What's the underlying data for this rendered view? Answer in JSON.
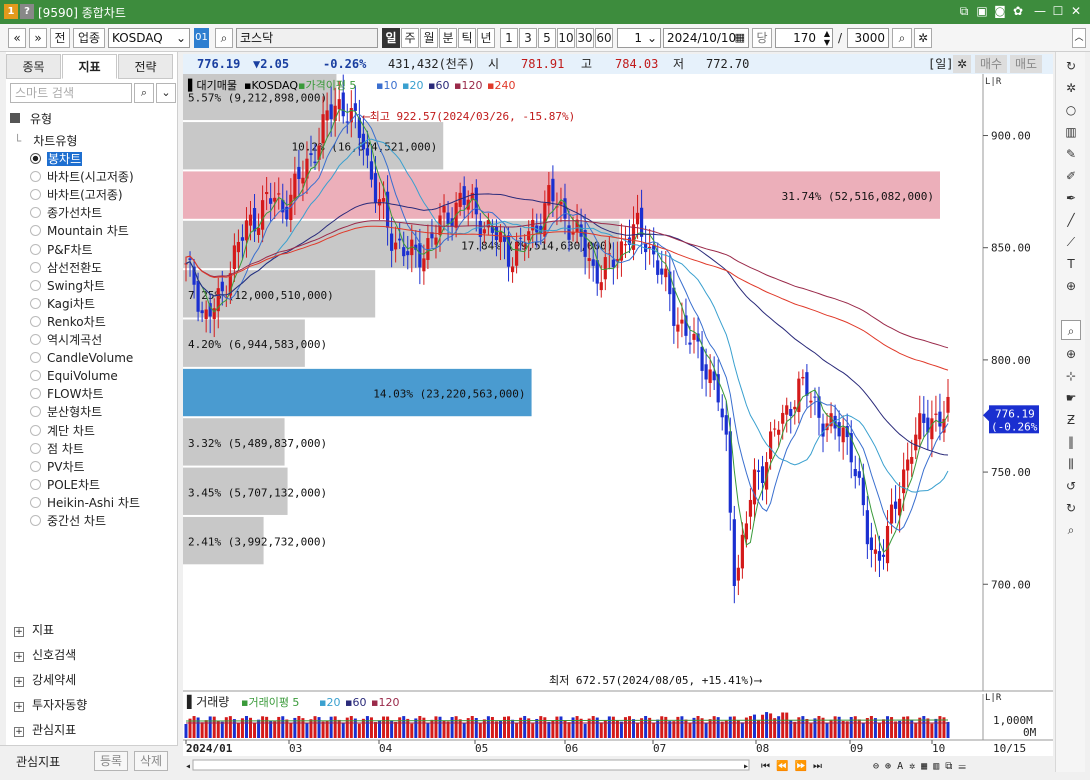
{
  "window": {
    "title": "[9590] 종합차트",
    "badge1": "1",
    "badge2": "?"
  },
  "toolbar": {
    "nav_back": "«",
    "nav_down": "»",
    "btn_all": "전",
    "btn_sector": "업종",
    "market_select": "KOSDAQ",
    "code_tag": "01",
    "index_name": "코스닥",
    "periods": [
      "일",
      "주",
      "월",
      "분",
      "틱",
      "년"
    ],
    "active_period": "일",
    "intervals": [
      "1",
      "3",
      "5",
      "10",
      "30",
      "60"
    ],
    "interval_value": "1",
    "date": "2024/10/10",
    "unit_label": "당",
    "count": "170",
    "slash": "/",
    "total": "3000"
  },
  "left_panel": {
    "tabs": [
      "종목",
      "지표",
      "전략"
    ],
    "active_tab": "지표",
    "search_placeholder": "스마트 검색",
    "folder_label": "유형",
    "group_label": "차트유형",
    "chart_types": [
      "봉차트",
      "바차트(시고저종)",
      "바차트(고저종)",
      "종가선차트",
      "Mountain 차트",
      "P&F차트",
      "삼선전환도",
      "Swing차트",
      "Kagi차트",
      "Renko차트",
      "역시계곡선",
      "CandleVolume",
      "EquiVolume",
      "FLOW차트",
      "분산형차트",
      "계단 차트",
      "점 차트",
      "PV차트",
      "POLE차트",
      "Heikin-Ashi 차트",
      "중간선 차트"
    ],
    "selected_type": "봉차트",
    "bottom_items": [
      "지표",
      "신호검색",
      "강세약세",
      "투자자동향",
      "관심지표"
    ],
    "watch_label": "관심지표",
    "register_btn": "등록",
    "delete_btn": "삭제"
  },
  "price_bar": {
    "last": "776.19",
    "change": "▼2.05",
    "change_pct": "-0.26%",
    "volume": "431,432(천주)",
    "open_label": "시",
    "open": "781.91",
    "high_label": "고",
    "high": "784.03",
    "low_label": "저",
    "low": "772.70",
    "period_tag": "[일]",
    "buy_btn": "매수",
    "sell_btn": "매도"
  },
  "legend": {
    "items": [
      {
        "label": "대기매물",
        "color": "#000000"
      },
      {
        "label": "KOSDAQ",
        "color": "#000000"
      },
      {
        "label": "가격이평 5",
        "color": "#3a9a3a"
      },
      {
        "label": "10",
        "color": "#3a6fcf"
      },
      {
        "label": "20",
        "color": "#3aa0cf"
      },
      {
        "label": "60",
        "color": "#2a2a7a"
      },
      {
        "label": "120",
        "color": "#9a2a4a"
      },
      {
        "label": "240",
        "color": "#e03a2a"
      }
    ]
  },
  "annotations": {
    "high": "최고 922.57(2024/03/26, -15.87%)",
    "low": "최저 672.57(2024/08/05, +15.41%)",
    "current_price": "776.19",
    "current_pct": "(-0.26%)"
  },
  "volume_legend": {
    "title": "거래량",
    "items": [
      {
        "label": "거래이평 5",
        "color": "#3a9a3a"
      },
      {
        "label": "20",
        "color": "#3aa0cf"
      },
      {
        "label": "60",
        "color": "#2a2a7a"
      },
      {
        "label": "120",
        "color": "#9a2a4a"
      }
    ],
    "scale_top": "1,000M",
    "scale_bottom": "0M"
  },
  "x_axis": {
    "labels": [
      "2024/01",
      "03",
      "04",
      "05",
      "06",
      "07",
      "08",
      "09",
      "10"
    ],
    "current_date": "10/15"
  },
  "chart_data": {
    "type": "candlestick",
    "ylim": [
      660,
      935
    ],
    "y_ticks": [
      700,
      750,
      800,
      850,
      900
    ],
    "y_tick_labels": [
      "700.00",
      "750.00",
      "800.00",
      "850.00",
      "900.00"
    ],
    "profile": [
      {
        "lo": 906,
        "hi": 928,
        "pct": 5.57,
        "label": "5.57% (9,212,898,000)"
      },
      {
        "lo": 884,
        "hi": 906,
        "pct": 10.2,
        "label": "10.2% (16,874,521,000)"
      },
      {
        "lo": 862,
        "hi": 884,
        "pct": 31.74,
        "label": "31.74% (52,516,082,000)"
      },
      {
        "lo": 840,
        "hi": 862,
        "pct": 17.84,
        "label": "17.84% (29,514,630,000)"
      },
      {
        "lo": 818,
        "hi": 840,
        "pct": 7.25,
        "label": "7.25% (12,000,510,000)"
      },
      {
        "lo": 796,
        "hi": 818,
        "pct": 4.2,
        "label": "4.20% (6,944,583,000)"
      },
      {
        "lo": 774,
        "hi": 796,
        "pct": 14.03,
        "label": "14.03% (23,220,563,000)"
      },
      {
        "lo": 752,
        "hi": 774,
        "pct": 3.32,
        "label": "3.32% (5,489,837,000)"
      },
      {
        "lo": 730,
        "hi": 752,
        "pct": 3.45,
        "label": "3.45% (5,707,132,000)"
      },
      {
        "lo": 708,
        "hi": 730,
        "pct": 2.41,
        "label": "2.41% (3,992,732,000)"
      }
    ],
    "close_path": [
      [
        0,
        840
      ],
      [
        3,
        835
      ],
      [
        6,
        818
      ],
      [
        9,
        822
      ],
      [
        12,
        828
      ],
      [
        15,
        842
      ],
      [
        18,
        852
      ],
      [
        21,
        860
      ],
      [
        24,
        864
      ],
      [
        27,
        870
      ],
      [
        30,
        872
      ],
      [
        33,
        868
      ],
      [
        36,
        874
      ],
      [
        39,
        882
      ],
      [
        42,
        890
      ],
      [
        45,
        898
      ],
      [
        48,
        908
      ],
      [
        51,
        915
      ],
      [
        54,
        912
      ],
      [
        57,
        905
      ],
      [
        60,
        898
      ],
      [
        63,
        880
      ],
      [
        66,
        868
      ],
      [
        69,
        855
      ],
      [
        72,
        852
      ],
      [
        75,
        848
      ],
      [
        78,
        845
      ],
      [
        81,
        850
      ],
      [
        84,
        856
      ],
      [
        87,
        862
      ],
      [
        90,
        866
      ],
      [
        93,
        872
      ],
      [
        96,
        870
      ],
      [
        99,
        864
      ],
      [
        102,
        858
      ],
      [
        105,
        855
      ],
      [
        108,
        850
      ],
      [
        111,
        846
      ],
      [
        114,
        852
      ],
      [
        117,
        858
      ],
      [
        120,
        863
      ],
      [
        123,
        872
      ],
      [
        126,
        870
      ],
      [
        129,
        862
      ],
      [
        132,
        856
      ],
      [
        135,
        850
      ],
      [
        138,
        840
      ],
      [
        141,
        838
      ],
      [
        144,
        843
      ],
      [
        147,
        850
      ],
      [
        150,
        856
      ],
      [
        153,
        858
      ],
      [
        156,
        853
      ],
      [
        159,
        844
      ],
      [
        162,
        835
      ],
      [
        165,
        822
      ],
      [
        168,
        815
      ],
      [
        171,
        808
      ],
      [
        174,
        802
      ],
      [
        177,
        795
      ],
      [
        180,
        785
      ],
      [
        183,
        760
      ],
      [
        186,
        700
      ],
      [
        189,
        722
      ],
      [
        192,
        745
      ],
      [
        195,
        752
      ],
      [
        198,
        763
      ],
      [
        201,
        772
      ],
      [
        204,
        778
      ],
      [
        207,
        788
      ],
      [
        210,
        786
      ],
      [
        213,
        780
      ],
      [
        216,
        772
      ],
      [
        219,
        768
      ],
      [
        222,
        770
      ],
      [
        225,
        762
      ],
      [
        228,
        740
      ],
      [
        231,
        720
      ],
      [
        234,
        712
      ],
      [
        237,
        718
      ],
      [
        240,
        735
      ],
      [
        243,
        750
      ],
      [
        246,
        762
      ],
      [
        249,
        770
      ],
      [
        252,
        776
      ],
      [
        255,
        772
      ],
      [
        258,
        777
      ]
    ]
  }
}
